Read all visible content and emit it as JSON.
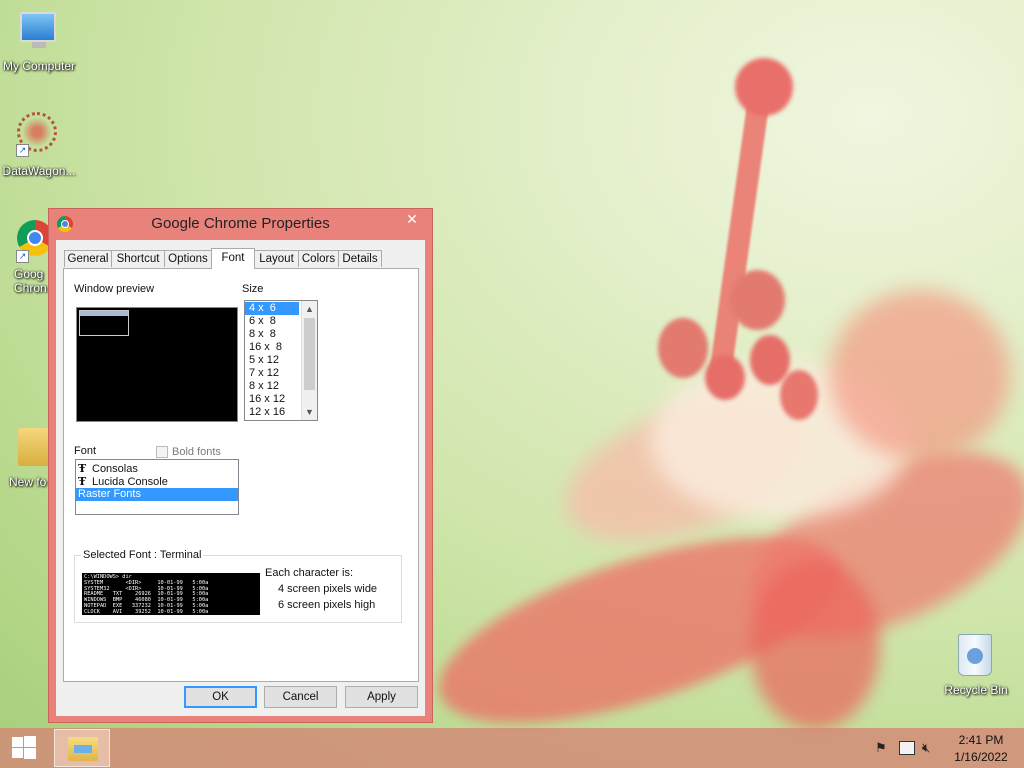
{
  "desktop": {
    "icons": [
      {
        "label": "My Computer"
      },
      {
        "label": "DataWagon..."
      },
      {
        "label": "Goog Chron"
      },
      {
        "label": "New fo"
      },
      {
        "label": "Recycle Bin"
      }
    ]
  },
  "dialog": {
    "title": "Google Chrome Properties",
    "close_glyph": "✕",
    "tabs": [
      "General",
      "Shortcut",
      "Options",
      "Font",
      "Layout",
      "Colors",
      "Details"
    ],
    "active_tab": "Font",
    "window_preview_label": "Window preview",
    "size_label": "Size",
    "sizes": [
      "4 x  6",
      "6 x  8",
      "8 x  8",
      "16 x  8",
      "5 x 12",
      "7 x 12",
      "8 x 12",
      "16 x 12",
      "12 x 16"
    ],
    "selected_size": "4 x  6",
    "font_label": "Font",
    "bold_fonts_label": "Bold fonts",
    "fonts": [
      "Consolas",
      "Lucida Console",
      "Raster Fonts"
    ],
    "selected_font": "Raster Fonts",
    "selected_font_label": "Selected Font : Terminal",
    "sample_text": "C:\\WINDOWS> dir\nSYSTEM       <DIR>     10-01-99   5:00a\nSYSTEM32     <DIR>     10-01-99   5:00a\nREADME   TXT    26926  10-01-99   5:00a\nWINDOWS  BMP    46080  10-01-99   5:00a\nNOTEPAD  EXE   337232  10-01-99   5:00a\nCLOCK    AVI    39252  10-01-99   5:00a",
    "each_char_label": "Each character is:",
    "pixels_wide": "4 screen pixels wide",
    "pixels_high": "6 screen pixels high",
    "buttons": {
      "ok": "OK",
      "cancel": "Cancel",
      "apply": "Apply"
    }
  },
  "taskbar": {
    "time": "2:41 PM",
    "date": "1/16/2022"
  },
  "colors": {
    "dialog_frame": "#e9827a",
    "selection": "#3399ff",
    "taskbar": "#d28c78"
  }
}
